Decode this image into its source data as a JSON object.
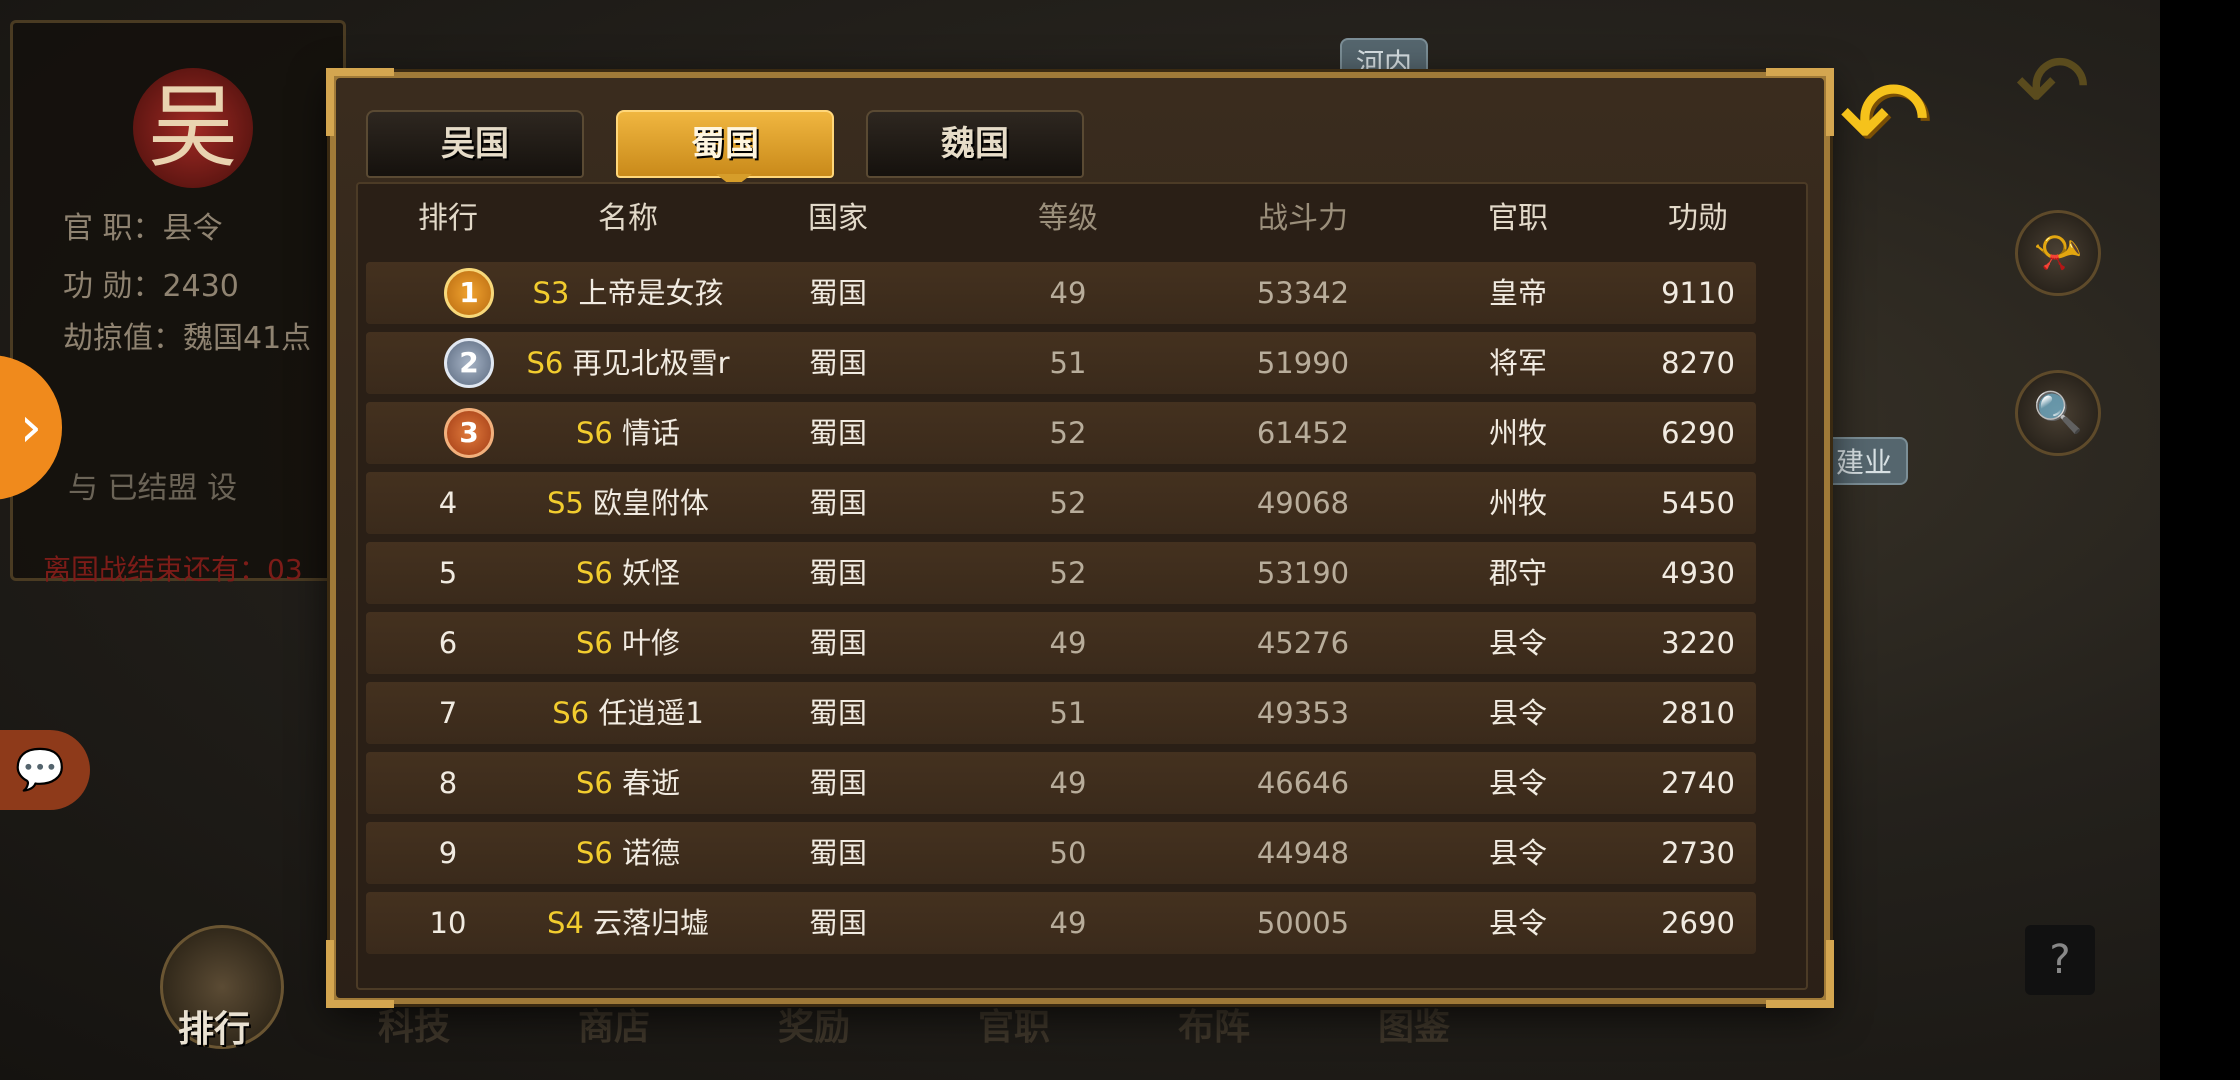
{
  "background": {
    "left_panel": {
      "emblem_char": "吴",
      "official_rank": "官  职：县令",
      "merit": "功  勋：2430",
      "plunder": "劫掠值：魏国41点",
      "alliance_text": "与  已结盟 设",
      "war_timer": "离国战结束还有：03"
    },
    "map_labels": [
      "河内",
      "建业"
    ],
    "bottom_nav": [
      "排行",
      "科技",
      "商店",
      "奖励",
      "官职",
      "布阵",
      "图鉴"
    ],
    "help_label": "?"
  },
  "dialog": {
    "tabs": [
      {
        "label": "吴国",
        "active": false
      },
      {
        "label": "蜀国",
        "active": true
      },
      {
        "label": "魏国",
        "active": false
      }
    ],
    "columns": [
      "排行",
      "名称",
      "国家",
      "等级",
      "战斗力",
      "官职",
      "功勋"
    ],
    "rows": [
      {
        "rank": "1",
        "server": "S3",
        "name": "上帝是女孩",
        "country": "蜀国",
        "level": "49",
        "power": "53342",
        "title": "皇帝",
        "merit": "9110"
      },
      {
        "rank": "2",
        "server": "S6",
        "name": "再见北极雪r",
        "country": "蜀国",
        "level": "51",
        "power": "51990",
        "title": "将军",
        "merit": "8270"
      },
      {
        "rank": "3",
        "server": "S6",
        "name": "情话",
        "country": "蜀国",
        "level": "52",
        "power": "61452",
        "title": "州牧",
        "merit": "6290"
      },
      {
        "rank": "4",
        "server": "S5",
        "name": "欧皇附体",
        "country": "蜀国",
        "level": "52",
        "power": "49068",
        "title": "州牧",
        "merit": "5450"
      },
      {
        "rank": "5",
        "server": "S6",
        "name": "妖怪",
        "country": "蜀国",
        "level": "52",
        "power": "53190",
        "title": "郡守",
        "merit": "4930"
      },
      {
        "rank": "6",
        "server": "S6",
        "name": "叶修",
        "country": "蜀国",
        "level": "49",
        "power": "45276",
        "title": "县令",
        "merit": "3220"
      },
      {
        "rank": "7",
        "server": "S6",
        "name": "任逍遥1",
        "country": "蜀国",
        "level": "51",
        "power": "49353",
        "title": "县令",
        "merit": "2810"
      },
      {
        "rank": "8",
        "server": "S6",
        "name": "春逝",
        "country": "蜀国",
        "level": "49",
        "power": "46646",
        "title": "县令",
        "merit": "2740"
      },
      {
        "rank": "9",
        "server": "S6",
        "name": "诺德",
        "country": "蜀国",
        "level": "50",
        "power": "44948",
        "title": "县令",
        "merit": "2730"
      },
      {
        "rank": "10",
        "server": "S4",
        "name": "云落归墟",
        "country": "蜀国",
        "level": "49",
        "power": "50005",
        "title": "县令",
        "merit": "2690"
      }
    ]
  },
  "colors": {
    "accent_gold": "#f0b640",
    "server_tag": "#f2cc2e",
    "back_arrow": "#f5c21b",
    "side_arrow": "#f08a1c"
  }
}
